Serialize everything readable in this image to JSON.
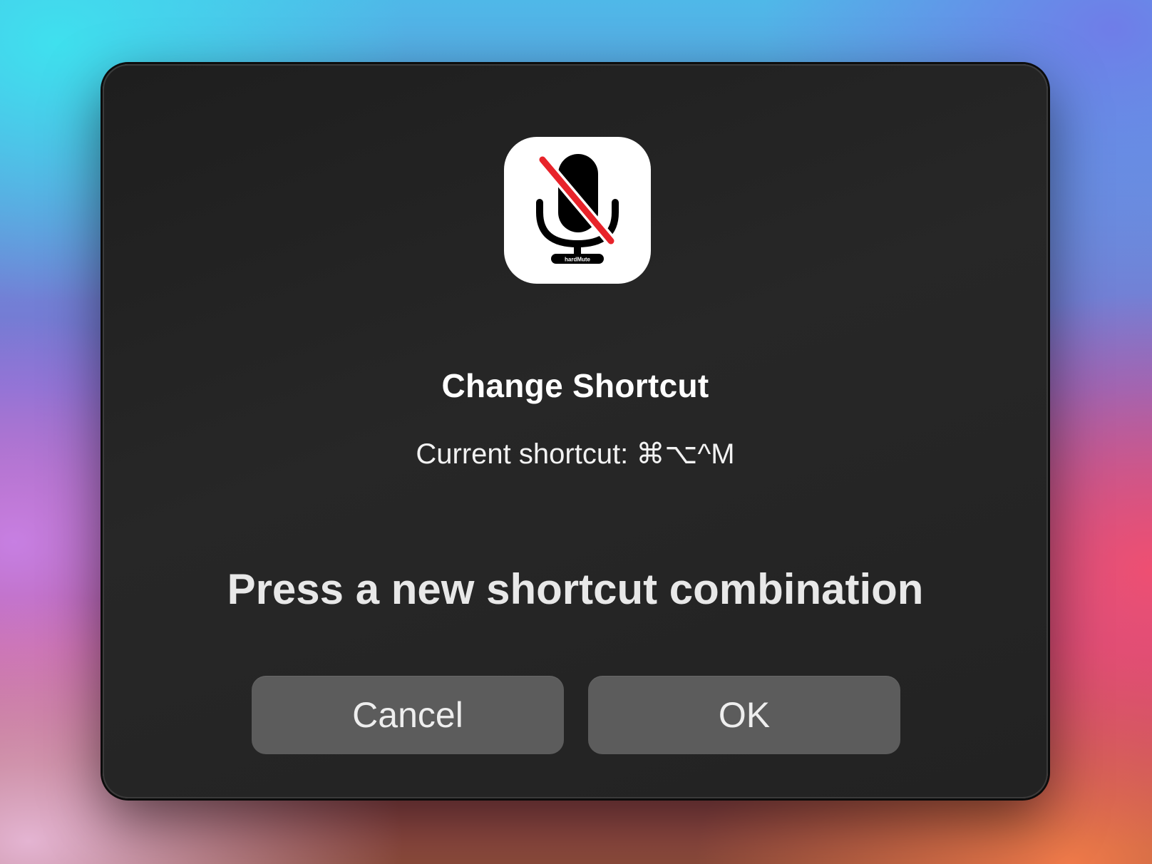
{
  "dialog": {
    "title": "Change Shortcut",
    "current_shortcut_text": "Current shortcut: ⌘⌥^M",
    "prompt": "Press a new shortcut combination",
    "cancel_label": "Cancel",
    "ok_label": "OK"
  },
  "app_icon": {
    "name": "muted-microphone-icon",
    "badge_text": "hardMute",
    "slash_color": "#e8232a",
    "mic_color": "#000000",
    "background_color": "#ffffff"
  }
}
